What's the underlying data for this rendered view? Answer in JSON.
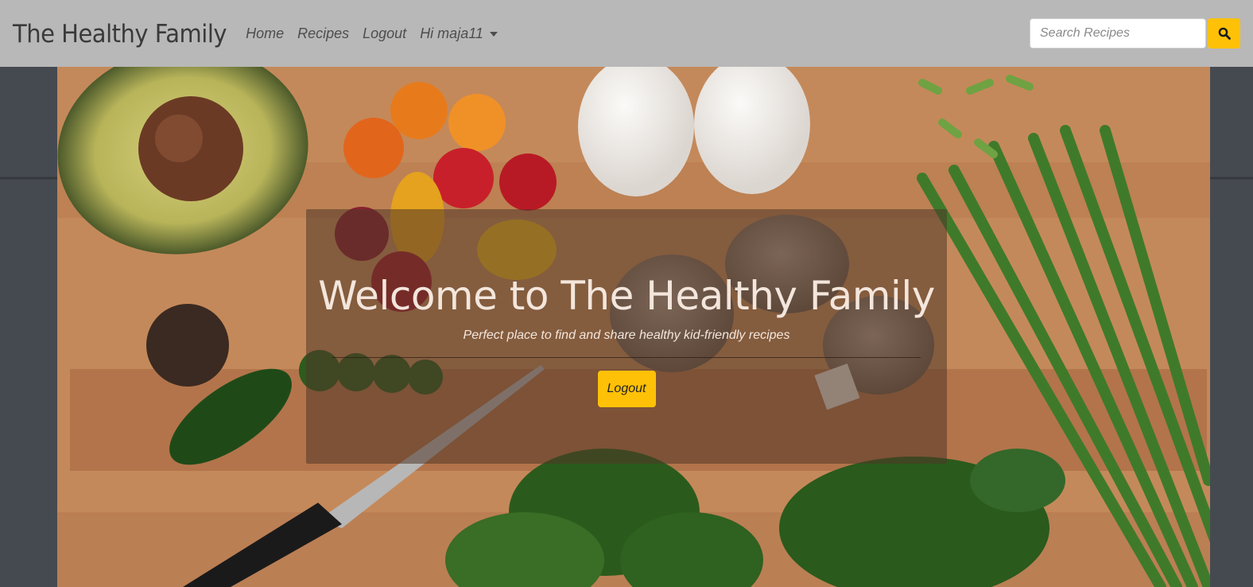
{
  "navbar": {
    "brand": "The Healthy Family",
    "links": [
      "Home",
      "Recipes",
      "Logout"
    ],
    "user_menu": "Hi maja11",
    "search": {
      "placeholder": "Search Recipes",
      "value": ""
    },
    "search_icon": "search-icon"
  },
  "hero": {
    "title": "Welcome to The Healthy Family",
    "subtitle": "Perfect place to find and share healthy kid-friendly recipes",
    "button_label": "Logout"
  },
  "colors": {
    "navbar_bg": "#b8b8b8",
    "accent": "#ffc107"
  }
}
